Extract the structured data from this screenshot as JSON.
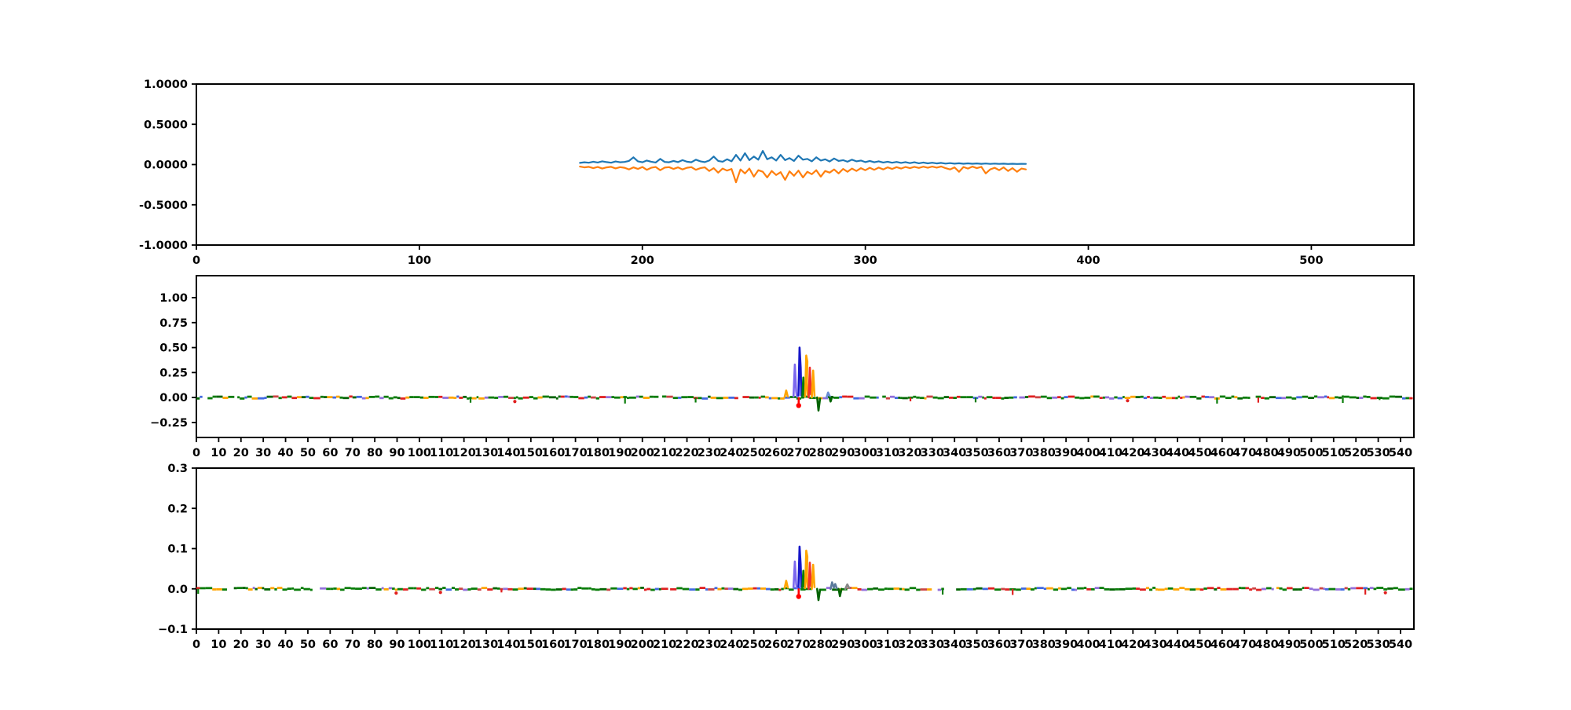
{
  "figure": {
    "background": "#ffffff",
    "text_color": "#000000",
    "axis_color": "#000000"
  },
  "chart_data": [
    {
      "id": "panel-top",
      "type": "line",
      "title": "",
      "xlabel": "",
      "ylabel": "",
      "grid": false,
      "legend": null,
      "xlim": [
        0,
        546
      ],
      "ylim": [
        -1.0,
        1.0
      ],
      "xticks": {
        "values": [
          0,
          100,
          200,
          300,
          400,
          500
        ],
        "labels": [
          "0",
          "100",
          "200",
          "300",
          "400",
          "500"
        ]
      },
      "yticks": {
        "values": [
          1.0,
          0.5,
          0.0,
          -0.5,
          -1.0
        ],
        "labels": [
          "1.0000",
          "0.5000",
          "0.0000",
          "-0.5000",
          "-1.0000"
        ]
      },
      "series": [
        {
          "name": "waveform-upper-blue",
          "color": "#1f77b4",
          "x_start": 172,
          "x_step": 2,
          "y": [
            0.02,
            0.028,
            0.022,
            0.035,
            0.025,
            0.04,
            0.03,
            0.022,
            0.038,
            0.028,
            0.032,
            0.045,
            0.09,
            0.04,
            0.028,
            0.05,
            0.035,
            0.025,
            0.07,
            0.032,
            0.028,
            0.045,
            0.03,
            0.055,
            0.035,
            0.028,
            0.06,
            0.04,
            0.03,
            0.05,
            0.1,
            0.045,
            0.035,
            0.065,
            0.04,
            0.12,
            0.05,
            0.14,
            0.055,
            0.1,
            0.06,
            0.17,
            0.065,
            0.09,
            0.05,
            0.12,
            0.055,
            0.08,
            0.045,
            0.11,
            0.06,
            0.07,
            0.04,
            0.09,
            0.05,
            0.065,
            0.038,
            0.075,
            0.045,
            0.055,
            0.035,
            0.06,
            0.04,
            0.05,
            0.03,
            0.045,
            0.028,
            0.04,
            0.025,
            0.035,
            0.022,
            0.032,
            0.02,
            0.03,
            0.018,
            0.028,
            0.016,
            0.025,
            0.015,
            0.022,
            0.014,
            0.02,
            0.012,
            0.018,
            0.011,
            0.016,
            0.01,
            0.015,
            0.01,
            0.014,
            0.009,
            0.013,
            0.008,
            0.012,
            0.008,
            0.011,
            0.007,
            0.01,
            0.007,
            0.009,
            0.008
          ]
        },
        {
          "name": "waveform-lower-orange",
          "color": "#ff7f0e",
          "x_start": 172,
          "x_step": 2,
          "y": [
            -0.025,
            -0.035,
            -0.028,
            -0.045,
            -0.03,
            -0.05,
            -0.035,
            -0.028,
            -0.048,
            -0.032,
            -0.04,
            -0.06,
            -0.035,
            -0.055,
            -0.03,
            -0.065,
            -0.04,
            -0.03,
            -0.07,
            -0.038,
            -0.032,
            -0.055,
            -0.035,
            -0.06,
            -0.04,
            -0.032,
            -0.065,
            -0.045,
            -0.035,
            -0.08,
            -0.045,
            -0.1,
            -0.05,
            -0.075,
            -0.055,
            -0.22,
            -0.06,
            -0.11,
            -0.05,
            -0.15,
            -0.07,
            -0.09,
            -0.16,
            -0.08,
            -0.13,
            -0.095,
            -0.19,
            -0.085,
            -0.14,
            -0.075,
            -0.16,
            -0.09,
            -0.12,
            -0.07,
            -0.15,
            -0.08,
            -0.1,
            -0.06,
            -0.11,
            -0.055,
            -0.09,
            -0.05,
            -0.08,
            -0.045,
            -0.07,
            -0.04,
            -0.065,
            -0.038,
            -0.06,
            -0.035,
            -0.055,
            -0.032,
            -0.05,
            -0.03,
            -0.045,
            -0.028,
            -0.042,
            -0.026,
            -0.04,
            -0.025,
            -0.038,
            -0.024,
            -0.045,
            -0.06,
            -0.035,
            -0.09,
            -0.03,
            -0.05,
            -0.025,
            -0.045,
            -0.028,
            -0.11,
            -0.06,
            -0.04,
            -0.07,
            -0.035,
            -0.08,
            -0.045,
            -0.09,
            -0.05,
            -0.06
          ]
        }
      ]
    },
    {
      "id": "panel-middle",
      "type": "line",
      "title": "",
      "xlabel": "",
      "ylabel": "",
      "grid": false,
      "legend": null,
      "xlim": [
        0,
        546
      ],
      "ylim": [
        -0.4,
        1.22
      ],
      "xticks": {
        "values": [
          0,
          10,
          20,
          30,
          40,
          50,
          60,
          70,
          80,
          90,
          100,
          110,
          120,
          130,
          140,
          150,
          160,
          170,
          180,
          190,
          200,
          210,
          220,
          230,
          240,
          250,
          260,
          270,
          280,
          290,
          300,
          310,
          320,
          330,
          340,
          350,
          360,
          370,
          380,
          390,
          400,
          410,
          420,
          430,
          440,
          450,
          460,
          470,
          480,
          490,
          500,
          510,
          520,
          530,
          540
        ],
        "labels": [
          "0",
          "10",
          "20",
          "30",
          "40",
          "50",
          "60",
          "70",
          "80",
          "90",
          "100",
          "110",
          "120",
          "130",
          "140",
          "150",
          "160",
          "170",
          "180",
          "190",
          "200",
          "210",
          "220",
          "230",
          "240",
          "250",
          "260",
          "270",
          "280",
          "290",
          "300",
          "310",
          "320",
          "330",
          "340",
          "350",
          "360",
          "370",
          "380",
          "390",
          "400",
          "410",
          "420",
          "430",
          "440",
          "450",
          "460",
          "470",
          "480",
          "490",
          "500",
          "510",
          "520",
          "530",
          "540"
        ]
      },
      "yticks": {
        "values": [
          1.0,
          0.75,
          0.5,
          0.25,
          0.0,
          -0.25
        ],
        "labels": [
          "1.00",
          "0.75",
          "0.50",
          "0.25",
          "0.00",
          "−0.25"
        ]
      },
      "baseline": {
        "y": 0,
        "x_range": [
          0,
          545.5
        ],
        "colors": [
          "#0a7d0a",
          "#006400",
          "#e02020",
          "#ffa500",
          "#9370db",
          "#4169e1",
          "#cc4444"
        ],
        "weights": [
          0.42,
          0.1,
          0.13,
          0.14,
          0.08,
          0.08,
          0.05
        ],
        "seed": 101
      },
      "spikes": [
        {
          "color": "#ffa500",
          "points": [
            [
              263.8,
              0.005
            ],
            [
              264.5,
              0.07
            ],
            [
              265.2,
              0.01
            ]
          ]
        },
        {
          "color": "#7b68ee",
          "points": [
            [
              267.8,
              0.01
            ],
            [
              268.4,
              0.33
            ],
            [
              269.0,
              0.06
            ],
            [
              269.3,
              0.01
            ]
          ]
        },
        {
          "color": "#1515c8",
          "points": [
            [
              270.0,
              0.02
            ],
            [
              270.5,
              0.5
            ],
            [
              271.0,
              0.3
            ],
            [
              271.3,
              0.02
            ]
          ]
        },
        {
          "color": "#0a7d0a",
          "points": [
            [
              271.7,
              0.0
            ],
            [
              272.2,
              0.2
            ],
            [
              272.7,
              0.02
            ]
          ]
        },
        {
          "color": "#ffa500",
          "points": [
            [
              273.0,
              0.01
            ],
            [
              273.5,
              0.42
            ],
            [
              274.0,
              0.36
            ],
            [
              273.8,
              0.15
            ],
            [
              274.2,
              0.02
            ]
          ]
        },
        {
          "color": "#f03030",
          "points": [
            [
              274.6,
              0.0
            ],
            [
              275.1,
              0.3
            ],
            [
              275.6,
              0.03
            ]
          ]
        },
        {
          "color": "#ffa500",
          "points": [
            [
              276.0,
              0.0
            ],
            [
              276.6,
              0.27
            ],
            [
              277.2,
              0.02
            ]
          ]
        },
        {
          "color": "#ff0000",
          "points": [
            [
              270.1,
              -0.005
            ],
            [
              270.1,
              -0.06
            ]
          ],
          "marker": [
            270.1,
            -0.08
          ]
        },
        {
          "color": "#006400",
          "points": [
            [
              278.4,
              0.0
            ],
            [
              279.0,
              -0.13
            ],
            [
              279.7,
              -0.01
            ]
          ]
        },
        {
          "color": "#6a8cd4",
          "points": [
            [
              282.6,
              0.0
            ],
            [
              283.3,
              0.05
            ],
            [
              284.1,
              0.01
            ]
          ]
        },
        {
          "color": "#006400",
          "points": [
            [
              283.9,
              0.0
            ],
            [
              284.4,
              -0.04
            ],
            [
              285.0,
              0.0
            ]
          ]
        }
      ],
      "series": []
    },
    {
      "id": "panel-bottom",
      "type": "line",
      "title": "",
      "xlabel": "",
      "ylabel": "",
      "grid": false,
      "legend": null,
      "xlim": [
        0,
        546
      ],
      "ylim": [
        -0.1,
        0.3
      ],
      "xticks": {
        "values": [
          0,
          10,
          20,
          30,
          40,
          50,
          60,
          70,
          80,
          90,
          100,
          110,
          120,
          130,
          140,
          150,
          160,
          170,
          180,
          190,
          200,
          210,
          220,
          230,
          240,
          250,
          260,
          270,
          280,
          290,
          300,
          310,
          320,
          330,
          340,
          350,
          360,
          370,
          380,
          390,
          400,
          410,
          420,
          430,
          440,
          450,
          460,
          470,
          480,
          490,
          500,
          510,
          520,
          530,
          540
        ],
        "labels": [
          "0",
          "10",
          "20",
          "30",
          "40",
          "50",
          "60",
          "70",
          "80",
          "90",
          "100",
          "110",
          "120",
          "130",
          "140",
          "150",
          "160",
          "170",
          "180",
          "190",
          "200",
          "210",
          "220",
          "230",
          "240",
          "250",
          "260",
          "270",
          "280",
          "290",
          "300",
          "310",
          "320",
          "330",
          "340",
          "350",
          "360",
          "370",
          "380",
          "390",
          "400",
          "410",
          "420",
          "430",
          "440",
          "450",
          "460",
          "470",
          "480",
          "490",
          "500",
          "510",
          "520",
          "530",
          "540"
        ]
      },
      "yticks": {
        "values": [
          0.3,
          0.2,
          0.1,
          0.0,
          -0.1
        ],
        "labels": [
          "0.3",
          "0.2",
          "0.1",
          "0.0",
          "−0.1"
        ]
      },
      "baseline": {
        "y": 0,
        "x_range": [
          0,
          545.5
        ],
        "colors": [
          "#0a7d0a",
          "#006400",
          "#e02020",
          "#ffa500",
          "#9370db",
          "#4169e1",
          "#cc4444"
        ],
        "weights": [
          0.42,
          0.1,
          0.13,
          0.14,
          0.08,
          0.08,
          0.05
        ],
        "seed": 202
      },
      "spikes": [
        {
          "color": "#ffa500",
          "points": [
            [
              263.8,
              0.002
            ],
            [
              264.5,
              0.02
            ],
            [
              265.2,
              0.003
            ]
          ]
        },
        {
          "color": "#7b68ee",
          "points": [
            [
              267.8,
              0.003
            ],
            [
              268.4,
              0.068
            ],
            [
              269.0,
              0.012
            ],
            [
              269.3,
              0.002
            ]
          ]
        },
        {
          "color": "#1515c8",
          "points": [
            [
              270.0,
              0.005
            ],
            [
              270.5,
              0.105
            ],
            [
              271.0,
              0.06
            ],
            [
              271.3,
              0.005
            ]
          ]
        },
        {
          "color": "#0a7d0a",
          "points": [
            [
              271.7,
              0.0
            ],
            [
              272.2,
              0.045
            ],
            [
              272.7,
              0.004
            ]
          ]
        },
        {
          "color": "#ffa500",
          "points": [
            [
              273.0,
              0.002
            ],
            [
              273.5,
              0.095
            ],
            [
              274.0,
              0.08
            ],
            [
              273.8,
              0.03
            ],
            [
              274.2,
              0.005
            ]
          ]
        },
        {
          "color": "#f03030",
          "points": [
            [
              274.6,
              0.0
            ],
            [
              275.1,
              0.065
            ],
            [
              275.6,
              0.006
            ]
          ]
        },
        {
          "color": "#ffa500",
          "points": [
            [
              276.0,
              0.0
            ],
            [
              276.6,
              0.06
            ],
            [
              277.2,
              0.004
            ]
          ]
        },
        {
          "color": "#ff0000",
          "points": [
            [
              270.1,
              -0.001
            ],
            [
              270.1,
              -0.014
            ]
          ],
          "marker": [
            270.1,
            -0.019
          ]
        },
        {
          "color": "#006400",
          "points": [
            [
              278.4,
              0.0
            ],
            [
              279.0,
              -0.028
            ],
            [
              279.7,
              -0.002
            ]
          ]
        },
        {
          "color": "#5b7b9c",
          "points": [
            [
              284.4,
              0.0
            ],
            [
              285.1,
              0.016
            ],
            [
              285.9,
              0.003
            ],
            [
              286.5,
              0.012
            ],
            [
              287.2,
              0.001
            ]
          ]
        },
        {
          "color": "#888888",
          "points": [
            [
              291.0,
              0.0
            ],
            [
              291.9,
              0.011
            ],
            [
              292.8,
              0.002
            ]
          ]
        },
        {
          "color": "#006400",
          "points": [
            [
              288.0,
              0.0
            ],
            [
              288.6,
              -0.018
            ],
            [
              289.3,
              0.0
            ]
          ]
        }
      ],
      "series": []
    }
  ]
}
